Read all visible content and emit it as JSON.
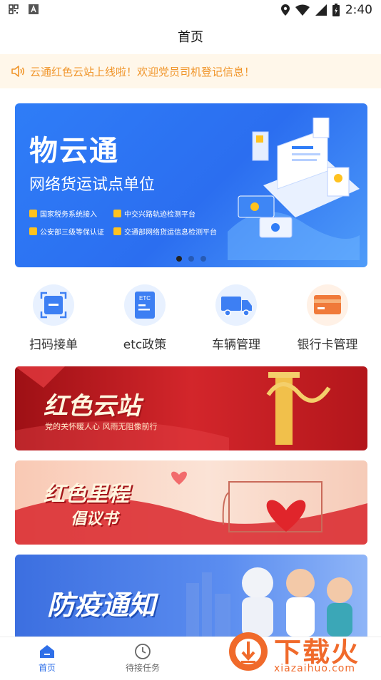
{
  "status_bar": {
    "time": "2:40"
  },
  "header": {
    "title": "首页"
  },
  "notice": {
    "text": "云通红色云站上线啦！欢迎党员司机登记信息！"
  },
  "banner": {
    "title": "物云通",
    "subtitle": "网络货运试点单位",
    "features": [
      "国家税务系统接入",
      "中交兴路轨迹检测平台",
      "公安部三级等保认证",
      "交通部网络货运信息检测平台"
    ],
    "page_count": 3,
    "active_page": 1
  },
  "shortcuts": [
    {
      "label": "扫码接单",
      "icon": "scan-icon"
    },
    {
      "label": "etc政策",
      "icon": "etc-card-icon",
      "icon_text": "ETC"
    },
    {
      "label": "车辆管理",
      "icon": "truck-icon"
    },
    {
      "label": "银行卡管理",
      "icon": "bank-card-icon"
    }
  ],
  "cards": [
    {
      "title": "红色云站",
      "subtitle": "党的关怀暖人心 风雨无阻像前行"
    },
    {
      "title": "红色里程",
      "subtitle": "倡议书"
    },
    {
      "title": "防疫通知"
    }
  ],
  "tabbar": {
    "items": [
      "首页",
      "待接任务"
    ]
  },
  "watermark": {
    "brand": "下载火",
    "url": "xiazaihuo.com"
  },
  "colors": {
    "accent": "#2f6fe8",
    "notice_text": "#f0952a",
    "notice_bg": "#fff7ea",
    "red": "#c81d22"
  }
}
